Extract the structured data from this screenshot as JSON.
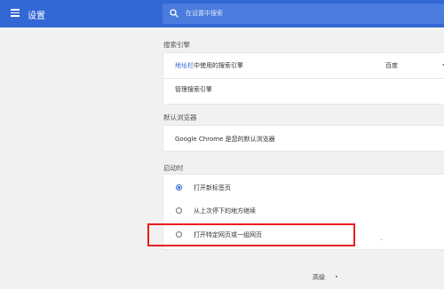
{
  "app": {
    "title": "设置"
  },
  "search": {
    "placeholder": "在设置中搜索"
  },
  "search_engine": {
    "section_title": "搜索引擎",
    "used_label_link": "地址栏",
    "used_label_rest": "中使用的搜索引擎",
    "selected_engine": "百度",
    "manage_label": "管理搜索引擎"
  },
  "default_browser": {
    "section_title": "默认浏览器",
    "status_text": "Google Chrome 是您的默认浏览器"
  },
  "on_startup": {
    "section_title": "启动时",
    "options": [
      {
        "label": "打开新标签页",
        "checked": true
      },
      {
        "label": "从上次停下的地方继续",
        "checked": false
      },
      {
        "label": "打开特定网页或一组网页",
        "checked": false
      }
    ]
  },
  "advanced": {
    "label": "高级"
  },
  "colors": {
    "accent": "#3367d6",
    "highlight_box": "#e61e1e",
    "link": "#3367d6"
  }
}
